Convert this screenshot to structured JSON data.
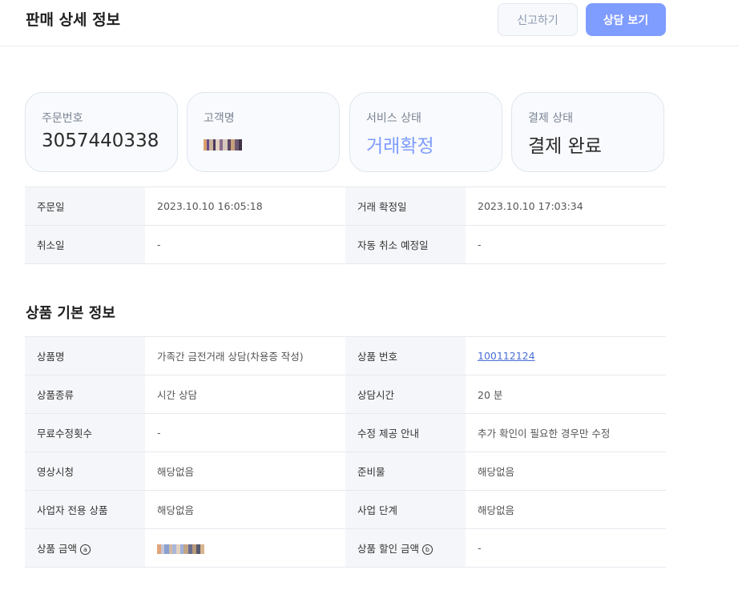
{
  "header": {
    "title": "판매 상세 정보",
    "report_button": "신고하기",
    "consult_button": "상담 보기"
  },
  "summary_cards": [
    {
      "label": "주문번호",
      "value": "3057440338"
    },
    {
      "label": "고객명",
      "value": ""
    },
    {
      "label": "서비스 상태",
      "value": "거래확정"
    },
    {
      "label": "결제 상태",
      "value": "결제 완료"
    }
  ],
  "order_table": [
    {
      "k1": "주문일",
      "v1": "2023.10.10 16:05:18",
      "k2": "거래 확정일",
      "v2": "2023.10.10 17:03:34"
    },
    {
      "k1": "취소일",
      "v1": "-",
      "k2": "자동 취소 예정일",
      "v2": "-"
    }
  ],
  "product_section": {
    "title": "상품 기본 정보",
    "rows": [
      {
        "k1": "상품명",
        "v1": "가족간 금전거래 상담(차용증 작성)",
        "k2": "상품 번호",
        "v2": "100112124"
      },
      {
        "k1": "상품종류",
        "v1": "시간 상담",
        "k2": "상담시간",
        "v2": "20 분"
      },
      {
        "k1": "무료수정횟수",
        "v1": "-",
        "k2": "수정 제공 안내",
        "v2": "추가 확인이 필요한 경우만 수정"
      },
      {
        "k1": "영상시청",
        "v1": "해당없음",
        "k2": "준비물",
        "v2": "해당없음"
      },
      {
        "k1": "사업자 전용 상품",
        "v1": "해당없음",
        "k2": "사업 단계",
        "v2": "해당없음"
      },
      {
        "k1": "상품 금액",
        "k1_mark": "a",
        "v1": "",
        "k2": "상품 할인 금액",
        "k2_mark": "b",
        "v2": "-"
      }
    ]
  },
  "colors": {
    "accent": "#7f9cff",
    "link": "#4a6fd6"
  }
}
